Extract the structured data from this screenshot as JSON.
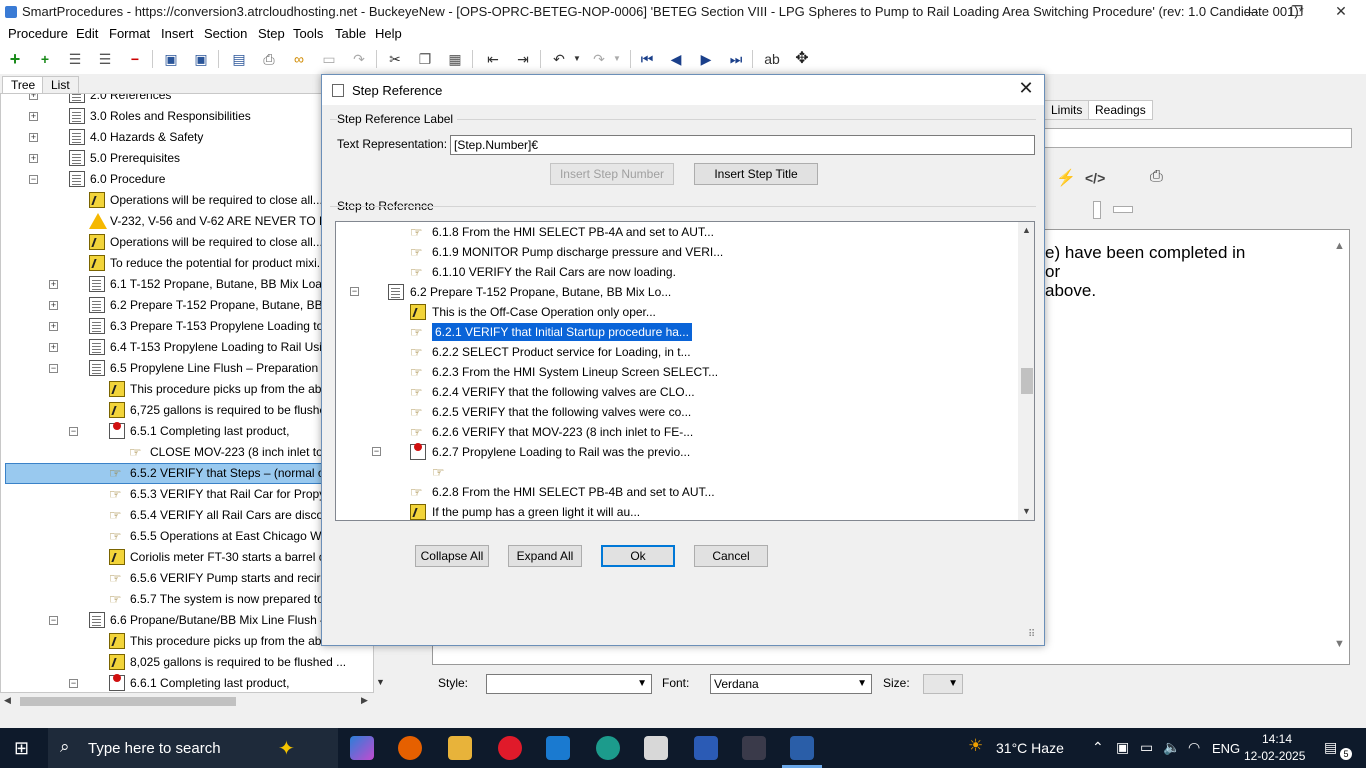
{
  "window": {
    "title": "SmartProcedures - https://conversion3.atrcloudhosting.net - BuckeyeNew - [OPS-OPRC-BETEG-NOP-0006] 'BETEG Section VIII - LPG Spheres to Pump to Rail Loading Area Switching Procedure' (rev: 1.0 Candidate 001)*",
    "minimize": "—",
    "restore": "❐",
    "close": "✕"
  },
  "menu": [
    "Procedure",
    "Edit",
    "Format",
    "Insert",
    "Section",
    "Step",
    "Tools",
    "Table",
    "Help"
  ],
  "left_tabs": [
    "Tree",
    "List"
  ],
  "tree": [
    {
      "label": "2.0 References",
      "level": 1,
      "icon": "page",
      "exp": "+"
    },
    {
      "label": "3.0 Roles and Responsibilities",
      "level": 1,
      "icon": "page",
      "exp": "+"
    },
    {
      "label": "4.0 Hazards & Safety",
      "level": 1,
      "icon": "page",
      "exp": "+"
    },
    {
      "label": "5.0 Prerequisites",
      "level": 1,
      "icon": "page",
      "exp": "+"
    },
    {
      "label": "6.0 Procedure",
      "level": 1,
      "icon": "page",
      "exp": "−"
    },
    {
      "label": "Operations will be required to close all...",
      "level": 2,
      "icon": "note"
    },
    {
      "label": "V-232, V-56 and V-62 ARE NEVER TO BE OPE...",
      "level": 2,
      "icon": "warn"
    },
    {
      "label": "Operations will be required to close all...",
      "level": 2,
      "icon": "note"
    },
    {
      "label": "To reduce the potential for product mixi...",
      "level": 2,
      "icon": "note"
    },
    {
      "label": "6.1 T-152 Propane, Butane, BB Mix Loading to...",
      "level": 2,
      "icon": "page",
      "exp": "+"
    },
    {
      "label": "6.2 Prepare T-152 Propane, Butane, BB Mix Lo...",
      "level": 2,
      "icon": "page",
      "exp": "+"
    },
    {
      "label": "6.3 Prepare T-153 Propylene Loading to Rail ...",
      "level": 2,
      "icon": "page",
      "exp": "+"
    },
    {
      "label": "6.4 T-153 Propylene Loading to Rail Using PB...",
      "level": 2,
      "icon": "page",
      "exp": "+"
    },
    {
      "label": "6.5 Propylene Line Flush – Preparation for P...",
      "level": 2,
      "icon": "page",
      "exp": "−"
    },
    {
      "label": "This procedure picks up from the above s...",
      "level": 3,
      "icon": "note"
    },
    {
      "label": "6,725 gallons is required to be flushed ...",
      "level": 3,
      "icon": "note"
    },
    {
      "label": "6.5.1 Completing last product,",
      "level": 3,
      "icon": "redpage",
      "exp": "−"
    },
    {
      "label": "CLOSE MOV-223 (8 inch inlet to FE-30 M",
      "level": 4,
      "icon": "hand"
    },
    {
      "label": "6.5.2 VERIFY that Steps – (normal operatio",
      "level": 3,
      "icon": "hand",
      "selected": true
    },
    {
      "label": "6.5.3 VERIFY that Rail Car for Propylene Tra",
      "level": 3,
      "icon": "hand"
    },
    {
      "label": "6.5.4 VERIFY all Rail Cars are disconnected a",
      "level": 3,
      "icon": "hand"
    },
    {
      "label": "6.5.5 Operations at East Chicago West, SEL",
      "level": 3,
      "icon": "hand"
    },
    {
      "label": "Coriolis meter FT-30 starts a barrel cou...",
      "level": 3,
      "icon": "note"
    },
    {
      "label": "6.5.6 VERIFY Pump starts and recirculation b",
      "level": 3,
      "icon": "hand"
    },
    {
      "label": "6.5.7 The system is now prepared to load Pr",
      "level": 3,
      "icon": "hand"
    },
    {
      "label": "6.6 Propane/Butane/BB Mix Line Flush – Prepa...",
      "level": 2,
      "icon": "page",
      "exp": "−"
    },
    {
      "label": "This procedure picks up from the above s...",
      "level": 3,
      "icon": "note"
    },
    {
      "label": "8,025 gallons is required to be flushed ...",
      "level": 3,
      "icon": "note"
    },
    {
      "label": "6.6.1 Completing last product,",
      "level": 3,
      "icon": "redpage",
      "exp": "−"
    }
  ],
  "right": {
    "tabs": [
      "Limits",
      "Readings"
    ],
    "editor_lines": [
      "e) have been completed in",
      "or",
      "above."
    ],
    "style_label": "Style:",
    "style_value": "",
    "font_label": "Font:",
    "font_value": "Verdana",
    "size_label": "Size:",
    "size_value": ""
  },
  "dialog": {
    "title": "Step Reference",
    "close": "✕",
    "group1": "Step Reference Label",
    "text_rep_label": "Text Representation:",
    "text_rep_value": "[Step.Number]€",
    "insert_number": "Insert Step Number",
    "insert_title": "Insert Step Title",
    "group2": "Step to Reference",
    "ref_tree": [
      {
        "label": "6.1.8 From the HMI SELECT PB-4A and set to AUT...",
        "level": 2,
        "icon": "hand"
      },
      {
        "label": "6.1.9 MONITOR Pump discharge pressure and VERI...",
        "level": 2,
        "icon": "hand"
      },
      {
        "label": "6.1.10 VERIFY the Rail Cars are now loading.",
        "level": 2,
        "icon": "hand"
      },
      {
        "label": "6.2 Prepare T-152 Propane, Butane, BB Mix Lo...",
        "level": 1,
        "icon": "page",
        "exp": "−"
      },
      {
        "label": "This is the Off-Case Operation only oper...",
        "level": 2,
        "icon": "note"
      },
      {
        "label": "6.2.1 VERIFY that Initial Startup procedure ha...",
        "level": 2,
        "icon": "hand",
        "selected": true
      },
      {
        "label": "6.2.2 SELECT Product service for Loading, in t...",
        "level": 2,
        "icon": "hand"
      },
      {
        "label": "6.2.3 From the HMI System Lineup Screen SELECT...",
        "level": 2,
        "icon": "hand"
      },
      {
        "label": "6.2.4 VERIFY that the following valves are CLO...",
        "level": 2,
        "icon": "hand"
      },
      {
        "label": "6.2.5 VERIFY that the following valves were co...",
        "level": 2,
        "icon": "hand"
      },
      {
        "label": "6.2.6 VERIFY that MOV-223 (8 inch inlet to FE-...",
        "level": 2,
        "icon": "hand"
      },
      {
        "label": "6.2.7 Propylene Loading to Rail was the previo...",
        "level": 2,
        "icon": "redpage",
        "exp": "−"
      },
      {
        "label": "",
        "level": 3,
        "icon": "hand"
      },
      {
        "label": "6.2.8 From the HMI SELECT PB-4B and set to AUT...",
        "level": 2,
        "icon": "hand"
      },
      {
        "label": "If the pump has a green light it will au...",
        "level": 2,
        "icon": "note"
      }
    ],
    "collapse_all": "Collapse All",
    "expand_all": "Expand All",
    "ok": "Ok",
    "cancel": "Cancel"
  },
  "taskbar": {
    "search_placeholder": "Type here to search",
    "weather": "31°C  Haze",
    "lang": "ENG",
    "time": "14:14",
    "date": "12-02-2025",
    "notif": "5"
  }
}
